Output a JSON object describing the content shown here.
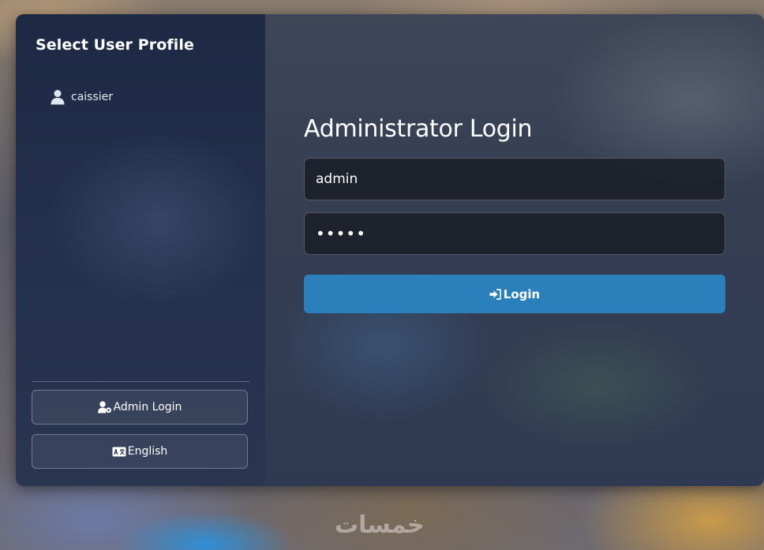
{
  "sidebar": {
    "title": "Select User Profile",
    "profiles": [
      {
        "label": "caissier",
        "icon": "user-icon"
      }
    ],
    "buttons": {
      "admin_login": {
        "label": "Admin Login",
        "icon": "user-gear-icon"
      },
      "language": {
        "label": "English",
        "icon": "language-icon"
      }
    }
  },
  "login": {
    "title": "Administrator Login",
    "username_value": "admin",
    "password_value": "•••••",
    "submit_label": "Login",
    "submit_icon": "sign-in-icon"
  },
  "watermark": "خمسات",
  "colors": {
    "accent": "#2b7fbb",
    "sidebar_bg": "#1e2a44",
    "input_bg": "#191c24"
  }
}
